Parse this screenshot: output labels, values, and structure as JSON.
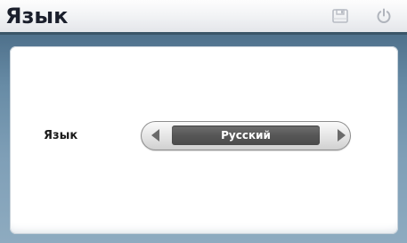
{
  "header": {
    "title": "Язык",
    "save_icon": "save-icon",
    "power_icon": "power-icon"
  },
  "setting": {
    "label": "Язык",
    "selected_value": "Русский",
    "prev_icon": "chevron-left-icon",
    "next_icon": "chevron-right-icon"
  },
  "colors": {
    "frame": "#6d8fa8",
    "header_text": "#1b1f2c",
    "value_box": "#575757",
    "value_text": "#ffffff"
  }
}
